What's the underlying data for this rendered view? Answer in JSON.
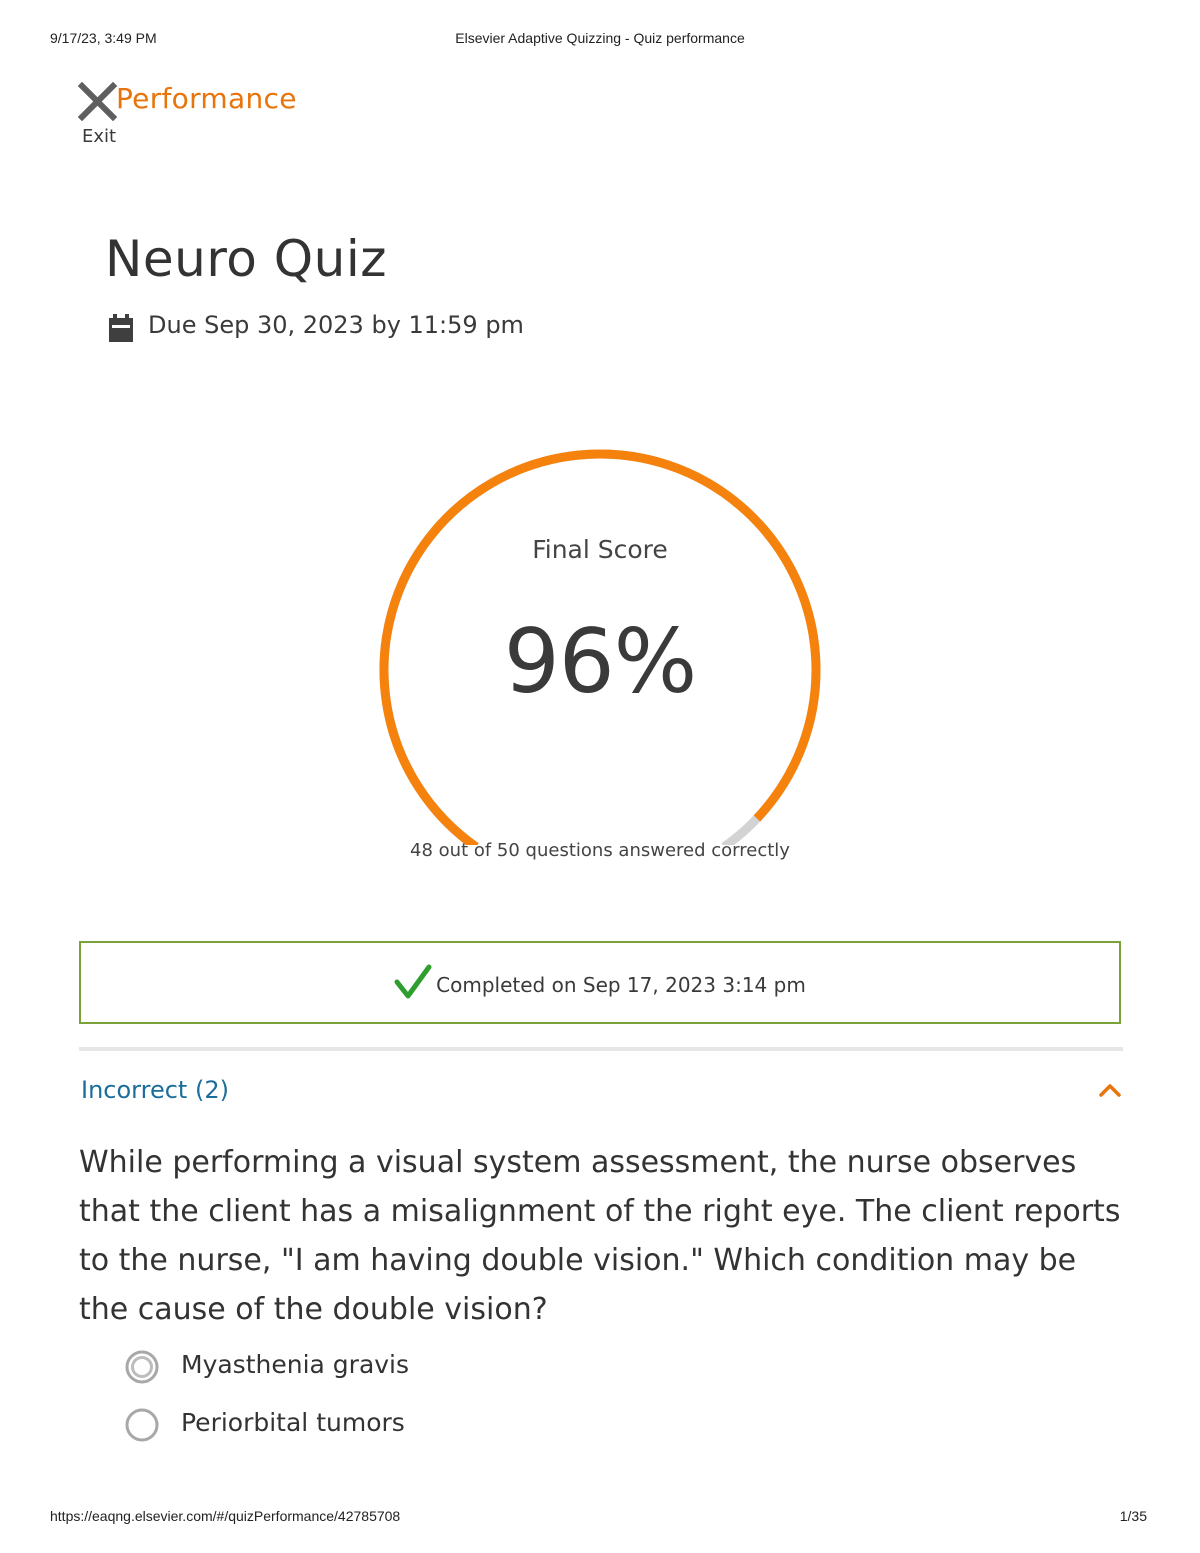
{
  "print": {
    "timestamp": "9/17/23, 3:49 PM",
    "doc_title": "Elsevier Adaptive Quizzing - Quiz performance",
    "url": "https://eaqng.elsevier.com/#/quizPerformance/42785708",
    "page_number": "1/35"
  },
  "header": {
    "exit_label": "Exit",
    "title": "Performance"
  },
  "quiz": {
    "title": "Neuro Quiz",
    "due": "Due Sep 30, 2023 by 11:59 pm"
  },
  "score": {
    "label": "Final Score",
    "value": "96%",
    "fraction": 0.96,
    "correct": 48,
    "total": 50,
    "caption": "48 out of 50 questions answered correctly"
  },
  "completed": {
    "text": "Completed on Sep 17, 2023 3:14 pm"
  },
  "incorrect_section": {
    "title": "Incorrect (2)",
    "question": "While performing a visual system assessment, the nurse observes that the client has a misalignment of the right eye. The client reports to the nurse, \"I am having double vision.\" Which condition may be the cause of the double vision?",
    "options": [
      {
        "label": "Myasthenia gravis",
        "selected": true
      },
      {
        "label": "Periorbital tumors",
        "selected": false
      }
    ]
  },
  "colors": {
    "accent_orange": "#f5820d",
    "link_blue": "#1c6e9a",
    "success_green": "#2e9e2e",
    "box_border_green": "#7aa238",
    "track_gray": "#d3d3d3"
  },
  "icons": {
    "exit": "close-x-icon",
    "due": "calendar-icon",
    "completed": "checkmark-icon",
    "collapse": "chevron-up-icon"
  }
}
